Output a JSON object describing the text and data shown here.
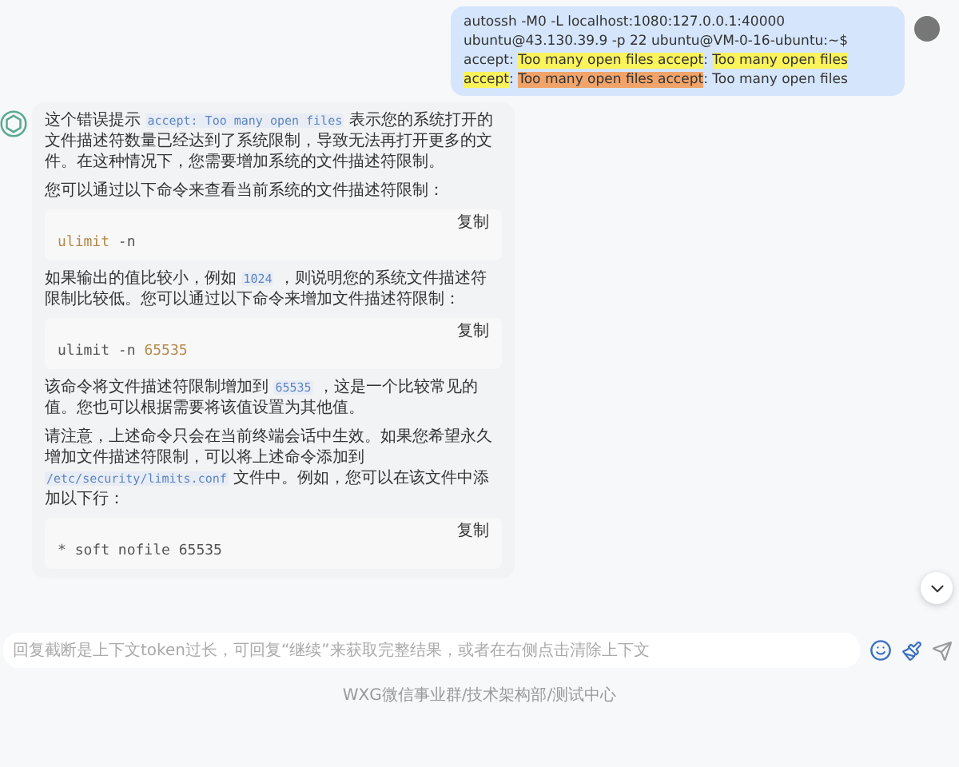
{
  "user_message": {
    "segments": [
      {
        "text": "autossh -M0 -L localhost:1080:127.0.0.1:40000 ubuntu@43.130.39.9 -p 22 ubuntu@VM-0-16-ubuntu:~$ accept: "
      },
      {
        "text": "Too many open files",
        "color": "#fbf35a"
      },
      {
        "text": " accept",
        "color": "#fbf35a"
      },
      {
        "text": ": "
      },
      {
        "text": "Too many open files accept",
        "color": "#fbf35a"
      },
      {
        "text": ": "
      },
      {
        "text": "Too many open files accept",
        "color": "#f0a46a"
      },
      {
        "text": ": Too many open files"
      }
    ]
  },
  "assistant_message": {
    "blocks": [
      {
        "kind": "paragraph",
        "segments": [
          {
            "kind": "text",
            "text": "这个错误提示 "
          },
          {
            "kind": "code",
            "text": "accept: Too many open files"
          },
          {
            "kind": "text",
            "text": " 表示您的系统打开的文件描述符数量已经达到了系统限制，导致无法再打开更多的文件。在这种情况下，您需要增加系统的文件描述符限制。"
          }
        ]
      },
      {
        "kind": "paragraph",
        "segments": [
          {
            "kind": "text",
            "text": "您可以通过以下命令来查看当前系统的文件描述符限制："
          }
        ]
      },
      {
        "kind": "code",
        "copy_label": "复制",
        "tokens": [
          {
            "kind": "keyword",
            "text": "ulimit"
          },
          {
            "kind": "plain",
            "text": " -n"
          }
        ]
      },
      {
        "kind": "paragraph",
        "segments": [
          {
            "kind": "text",
            "text": "如果输出的值比较小，例如 "
          },
          {
            "kind": "code",
            "text": "1024"
          },
          {
            "kind": "text",
            "text": " ，则说明您的系统文件描述符限制比较低。您可以通过以下命令来增加文件描述符限制："
          }
        ]
      },
      {
        "kind": "code",
        "copy_label": "复制",
        "tokens": [
          {
            "kind": "plain",
            "text": "ulimit -n "
          },
          {
            "kind": "number",
            "text": "65535"
          }
        ]
      },
      {
        "kind": "paragraph",
        "segments": [
          {
            "kind": "text",
            "text": "该命令将文件描述符限制增加到 "
          },
          {
            "kind": "code",
            "text": "65535"
          },
          {
            "kind": "text",
            "text": " ，这是一个比较常见的值。您也可以根据需要将该值设置为其他值。"
          }
        ]
      },
      {
        "kind": "paragraph",
        "segments": [
          {
            "kind": "text",
            "text": "请注意，上述命令只会在当前终端会话中生效。如果您希望永久增加文件描述符限制，可以将上述命令添加到 "
          },
          {
            "kind": "code",
            "text": "/etc/security/limits.conf"
          },
          {
            "kind": "text",
            "text": " 文件中。例如，您可以在该文件中添加以下行："
          }
        ]
      },
      {
        "kind": "code",
        "copy_label": "复制",
        "tokens": [
          {
            "kind": "plain",
            "text": "* soft nofile 65535"
          }
        ]
      }
    ]
  },
  "input": {
    "placeholder": "回复截断是上下文token过长，可回复“继续”来获取完整结果，或者在右侧点击清除上下文"
  },
  "footer": "WXG微信事业群/技术架构部/测试中心"
}
